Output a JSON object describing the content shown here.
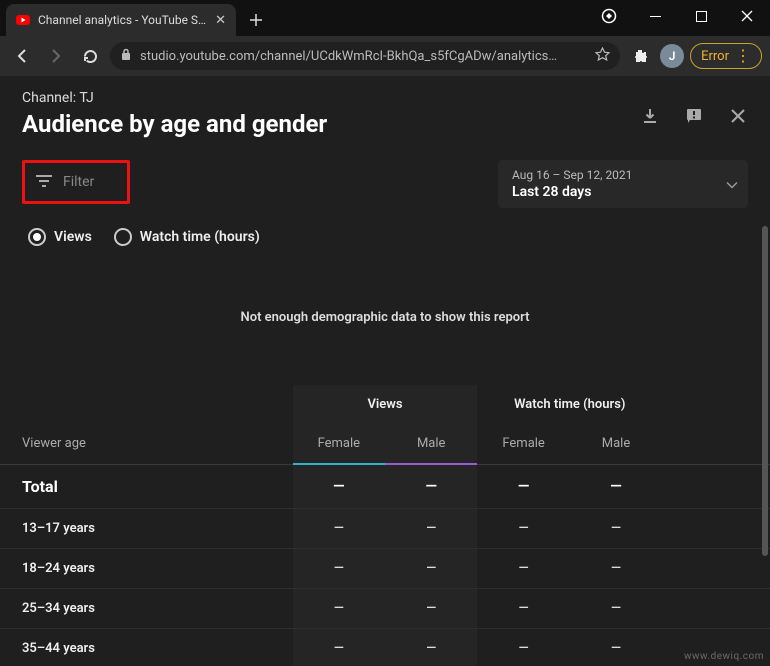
{
  "window": {
    "tab_title": "Channel analytics - YouTube Stud",
    "url": "studio.youtube.com/channel/UCdkWmRcI-BkhQa_s5fCgADw/analytics…",
    "avatar_letter": "J",
    "error_chip": "Error"
  },
  "header": {
    "channel_label": "Channel: TJ",
    "page_title": "Audience by age and gender"
  },
  "filter": {
    "label": "Filter"
  },
  "date": {
    "range": "Aug 16 – Sep 12, 2021",
    "preset": "Last 28 days"
  },
  "metrics": {
    "views": "Views",
    "watch_time": "Watch time (hours)"
  },
  "empty_message": "Not enough demographic data to show this report",
  "table": {
    "row_header": "Viewer age",
    "group_views": "Views",
    "group_watch": "Watch time (hours)",
    "female": "Female",
    "male": "Male",
    "rows": [
      {
        "label": "Total",
        "vals": [
          "—",
          "—",
          "—",
          "—"
        ],
        "total": true
      },
      {
        "label": "13–17 years",
        "vals": [
          "—",
          "—",
          "—",
          "—"
        ]
      },
      {
        "label": "18–24 years",
        "vals": [
          "—",
          "—",
          "—",
          "—"
        ]
      },
      {
        "label": "25–34 years",
        "vals": [
          "—",
          "—",
          "—",
          "—"
        ]
      },
      {
        "label": "35–44 years",
        "vals": [
          "—",
          "—",
          "—",
          "—"
        ]
      }
    ]
  },
  "watermark": "www.dewiq.com"
}
